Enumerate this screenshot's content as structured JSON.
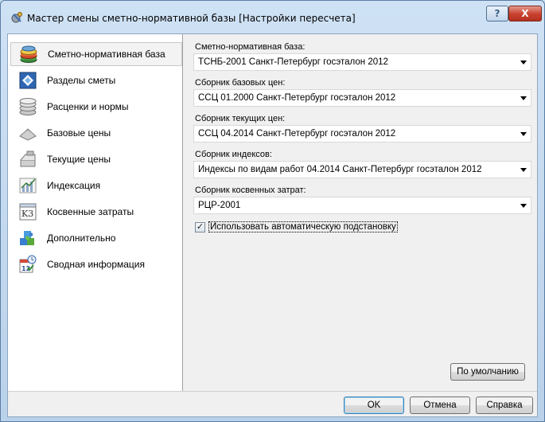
{
  "window": {
    "title": "Мастер смены сметно-нормативной базы [Настройки пересчета]",
    "help_label": "?",
    "close_label": "X"
  },
  "sidebar": {
    "items": [
      {
        "label": "Сметно-нормативная база",
        "icon": "database-stack-icon"
      },
      {
        "label": "Разделы сметы",
        "icon": "sections-icon"
      },
      {
        "label": "Расценки и нормы",
        "icon": "coins-stack-icon"
      },
      {
        "label": "Базовые цены",
        "icon": "base-prices-icon"
      },
      {
        "label": "Текущие цены",
        "icon": "current-prices-icon"
      },
      {
        "label": "Индексация",
        "icon": "chart-icon"
      },
      {
        "label": "Косвенные затраты",
        "icon": "indirect-costs-icon"
      },
      {
        "label": "Дополнительно",
        "icon": "puzzle-icon"
      },
      {
        "label": "Сводная информация",
        "icon": "calendar-clock-icon"
      }
    ]
  },
  "form": {
    "normative_base": {
      "label": "Сметно-нормативная база:",
      "value": "ТСНБ-2001 Санкт-Петербург госэталон 2012"
    },
    "base_prices": {
      "label": "Сборник базовых цен:",
      "value": "ССЦ 01.2000 Санкт-Петербург госэталон 2012"
    },
    "current_prices": {
      "label": "Сборник текущих цен:",
      "value": "ССЦ 04.2014 Санкт-Петербург госэталон 2012"
    },
    "indexes": {
      "label": "Сборник индексов:",
      "value": "Индексы по видам работ 04.2014 Санкт-Петербург госэталон 2012"
    },
    "indirect_costs": {
      "label": "Сборник косвенных затрат:",
      "value": "РЦР-2001"
    },
    "auto_substitution": {
      "label": "Использовать автоматическую подстановку",
      "checked": true,
      "mark": "✓"
    }
  },
  "buttons": {
    "defaults": "По умолчанию",
    "ok": "OK",
    "cancel": "Отмена",
    "help": "Справка"
  }
}
